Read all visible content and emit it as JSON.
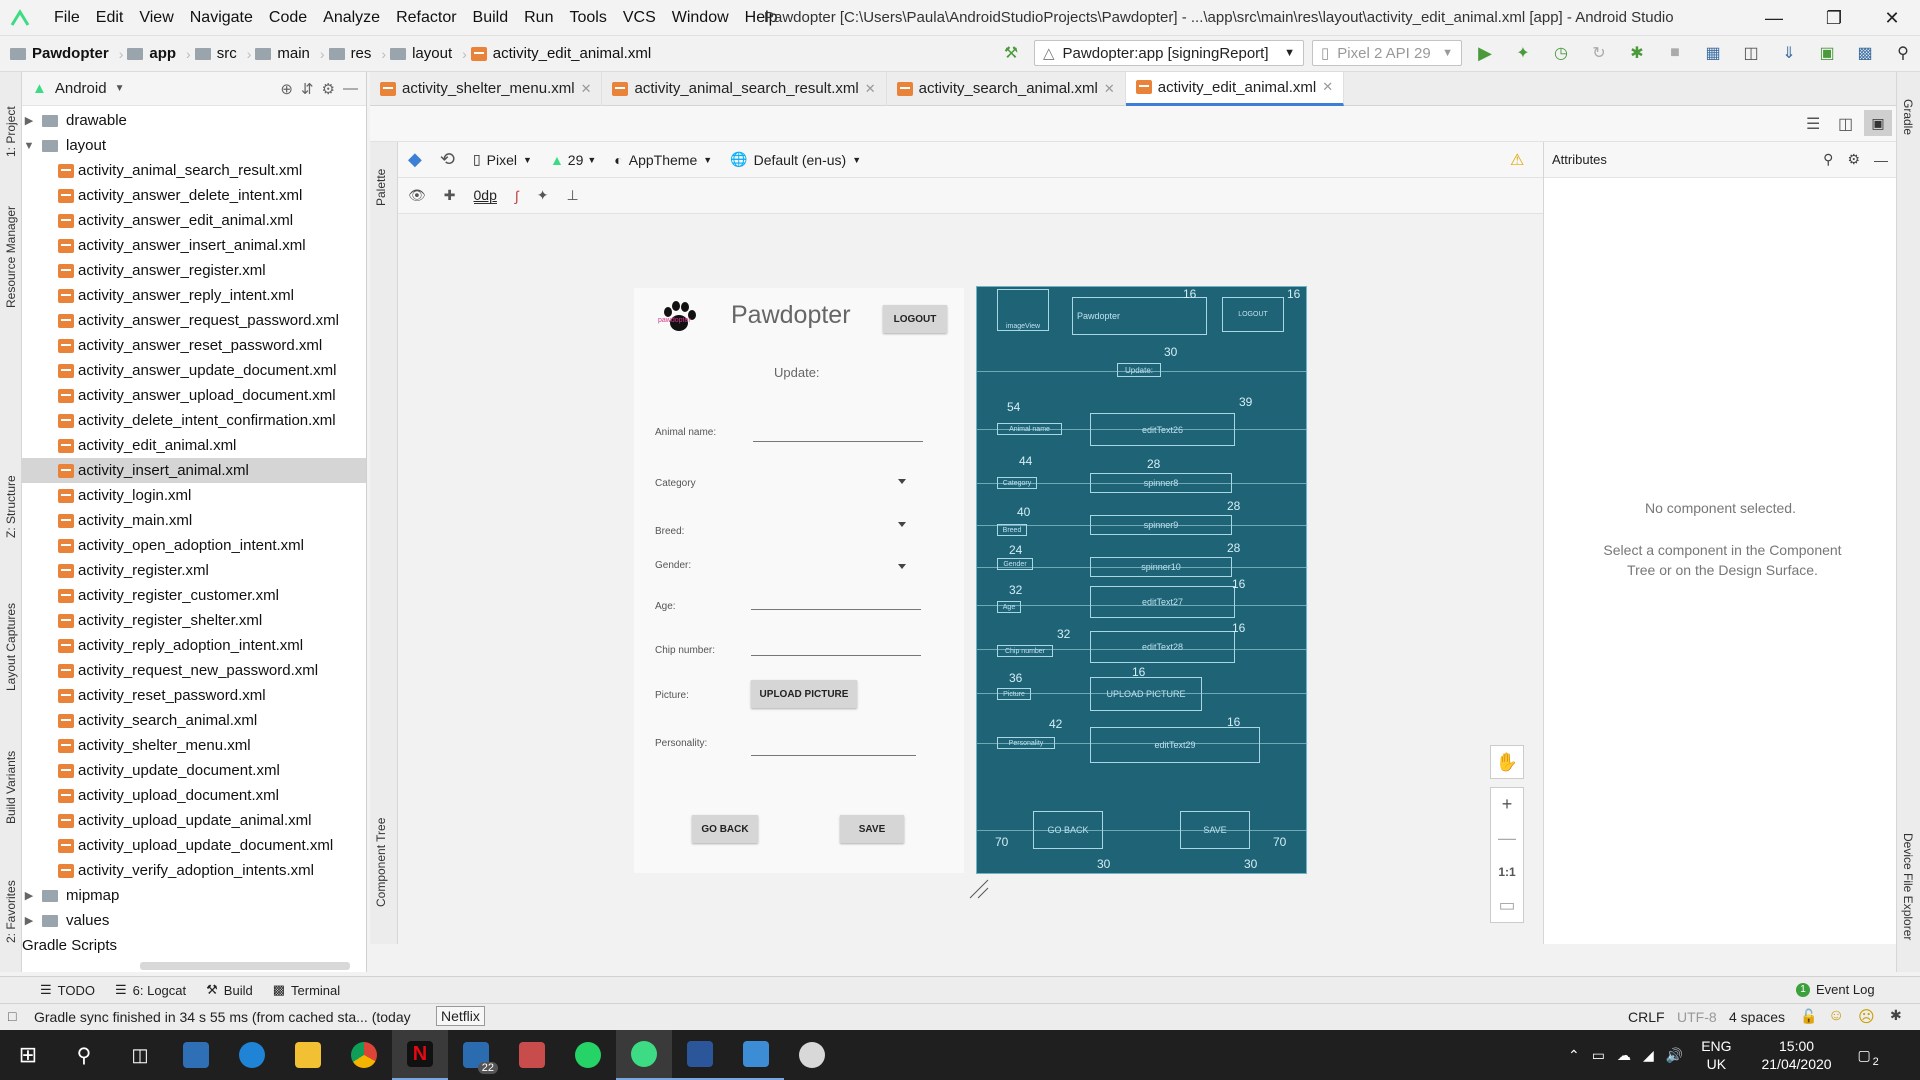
{
  "titlebar": {
    "menus": [
      "File",
      "Edit",
      "View",
      "Navigate",
      "Code",
      "Analyze",
      "Refactor",
      "Build",
      "Run",
      "Tools",
      "VCS",
      "Window",
      "Help"
    ],
    "window_title": "Pawdopter [C:\\Users\\Paula\\AndroidStudioProjects\\Pawdopter] - ...\\app\\src\\main\\res\\layout\\activity_edit_animal.xml [app] - Android Studio"
  },
  "navbar": {
    "crumbs": [
      "Pawdopter",
      "app",
      "src",
      "main",
      "res",
      "layout",
      "activity_edit_animal.xml"
    ],
    "run_config": "Pawdopter:app [signingReport]",
    "device": "Pixel 2 API 29"
  },
  "project": {
    "view_mode": "Android",
    "folders": {
      "drawable": "drawable",
      "layout": "layout",
      "mipmap": "mipmap",
      "values": "values",
      "gradle": "Gradle Scripts"
    },
    "files": [
      "activity_animal_search_result.xml",
      "activity_answer_delete_intent.xml",
      "activity_answer_edit_animal.xml",
      "activity_answer_insert_animal.xml",
      "activity_answer_register.xml",
      "activity_answer_reply_intent.xml",
      "activity_answer_request_password.xml",
      "activity_answer_reset_password.xml",
      "activity_answer_update_document.xml",
      "activity_answer_upload_document.xml",
      "activity_delete_intent_confirmation.xml",
      "activity_edit_animal.xml",
      "activity_insert_animal.xml",
      "activity_login.xml",
      "activity_main.xml",
      "activity_open_adoption_intent.xml",
      "activity_register.xml",
      "activity_register_customer.xml",
      "activity_register_shelter.xml",
      "activity_reply_adoption_intent.xml",
      "activity_request_new_password.xml",
      "activity_reset_password.xml",
      "activity_search_animal.xml",
      "activity_shelter_menu.xml",
      "activity_update_document.xml",
      "activity_upload_document.xml",
      "activity_upload_update_animal.xml",
      "activity_upload_update_document.xml",
      "activity_verify_adoption_intents.xml"
    ],
    "selected_file": "activity_insert_animal.xml"
  },
  "left_tabs": [
    "1: Project",
    "Resource Manager",
    "Z: Structure",
    "Layout Captures",
    "Build Variants",
    "2: Favorites"
  ],
  "right_tabs": [
    "Gradle",
    "Device File Explorer"
  ],
  "editor_tabs": [
    "activity_shelter_menu.xml",
    "activity_animal_search_result.xml",
    "activity_search_animal.xml",
    "activity_edit_animal.xml"
  ],
  "active_tab": "activity_edit_animal.xml",
  "design_toolbar": {
    "device": "Pixel",
    "api": "29",
    "theme": "AppTheme",
    "locale": "Default (en-us)",
    "margin": "0dp"
  },
  "side_tabs": {
    "palette": "Palette",
    "component_tree": "Component Tree"
  },
  "attributes": {
    "title": "Attributes",
    "empty_title": "No component selected.",
    "empty_hint": "Select a component in the Component Tree or on the Design Surface."
  },
  "design": {
    "app_name": "Pawdopter",
    "logo_text": "pawdopter",
    "logout": "LOGOUT",
    "heading": "Update:",
    "labels": {
      "animal_name": "Animal name:",
      "category": "Category",
      "breed": "Breed:",
      "gender": "Gender:",
      "age": "Age:",
      "chip": "Chip number:",
      "picture": "Picture:",
      "personality": "Personality:"
    },
    "upload": "UPLOAD PICTURE",
    "go_back": "GO BACK",
    "save": "SAVE"
  },
  "blueprint": {
    "pawdopter": "Pawdopter",
    "update": "Update:",
    "edit26": "editText26",
    "spinner8": "spinner8",
    "spinner9": "spinner9",
    "spinner10": "spinner10",
    "edit27": "editText27",
    "edit28": "editText28",
    "upload": "UPLOAD PICTURE",
    "edit29": "editText29",
    "go_back": "GO BACK",
    "save": "SAVE",
    "small_labels": {
      "img": "imageView",
      "logout": "LOGOUT",
      "animal": "Animal name",
      "category": "Category",
      "breed": "Breed",
      "gender": "Gender",
      "age": "Age",
      "chip": "Chip number",
      "picture": "Picture",
      "personality": "Personality"
    },
    "numbers": {
      "n16a": "16",
      "n16b": "16",
      "n30": "30",
      "n54": "54",
      "n39": "39",
      "n44": "44",
      "n28a": "28",
      "n40": "40",
      "n28b": "28",
      "n24": "24",
      "n28c": "28",
      "n32a": "32",
      "n16c": "16",
      "n32b": "32",
      "n16d": "16",
      "n36": "36",
      "n16e": "16",
      "n42": "42",
      "n16f": "16",
      "n70a": "70",
      "n70b": "70",
      "n30b": "30",
      "n30c": "30"
    }
  },
  "zoom": {
    "one_to_one": "1:1"
  },
  "bottom_tools": {
    "todo": "TODO",
    "logcat": "6: Logcat",
    "build": "Build",
    "terminal": "Terminal",
    "event_log": "Event Log"
  },
  "status": {
    "message": "Gradle sync finished in 34 s 55 ms (from cached sta... (today",
    "tooltip": "Netflix",
    "line_sep": "CRLF",
    "encoding": "UTF-8",
    "indent": "4 spaces"
  },
  "taskbar": {
    "mail_badge": "22",
    "lang": "ENG",
    "region": "UK",
    "time": "15:00",
    "date": "21/04/2020",
    "notif_count": "2"
  }
}
